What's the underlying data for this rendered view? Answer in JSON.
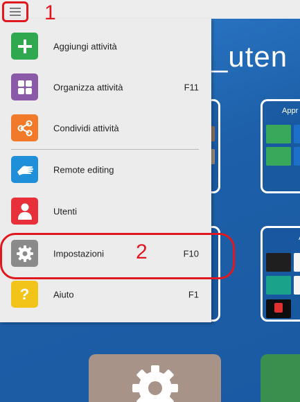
{
  "annotations": {
    "marker_1": "1",
    "marker_2": "2"
  },
  "background": {
    "title": "s_uten",
    "card_top_right_label": "Appr",
    "card_mid_right_label": "A"
  },
  "menu": {
    "items": [
      {
        "label": "Aggiungi attività",
        "key": "",
        "icon": "plus-icon",
        "color": "#2fa84f"
      },
      {
        "label": "Organizza attività",
        "key": "F11",
        "icon": "grid-icon",
        "color": "#8a5aa8"
      },
      {
        "label": "Condividi attività",
        "key": "",
        "icon": "share-icon",
        "color": "#f07a2a"
      },
      {
        "label": "Remote editing",
        "key": "",
        "icon": "hand-icon",
        "color": "#1e8fd8"
      },
      {
        "label": "Utenti",
        "key": "",
        "icon": "user-icon",
        "color": "#e8303a"
      },
      {
        "label": "Impostazioni",
        "key": "F10",
        "icon": "gear-icon",
        "color": "#8a8a8a"
      },
      {
        "label": "Aiuto",
        "key": "F1",
        "icon": "question-icon",
        "color": "#f2c318"
      }
    ]
  }
}
